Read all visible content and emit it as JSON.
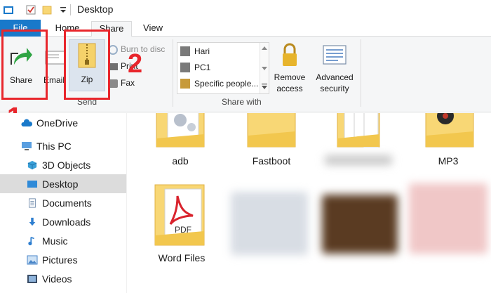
{
  "window": {
    "title": "Desktop"
  },
  "tabs": [
    {
      "label": "File"
    },
    {
      "label": "Home"
    },
    {
      "label": "Share"
    },
    {
      "label": "View"
    }
  ],
  "ribbon": {
    "send_group": {
      "label": "Send",
      "share_label": "Share",
      "email_label": "Email",
      "zip_label": "Zip",
      "burn_label": "Burn to disc",
      "print_label": "Print",
      "fax_label": "Fax"
    },
    "share_with_group": {
      "label": "Share with",
      "people": [
        "Hari",
        "PC1",
        "Specific people..."
      ],
      "remove_access_label": [
        "Remove",
        "access"
      ],
      "advanced_security_label": [
        "Advanced",
        "security"
      ]
    }
  },
  "annotations": {
    "step1": "1",
    "step2": "2"
  },
  "nav": {
    "items": [
      {
        "label": "OneDrive",
        "icon": "cloud-icon"
      },
      {
        "label": "This PC",
        "icon": "computer-icon"
      },
      {
        "label": "3D Objects",
        "icon": "cube-icon"
      },
      {
        "label": "Desktop",
        "icon": "desktop-icon"
      },
      {
        "label": "Documents",
        "icon": "document-icon"
      },
      {
        "label": "Downloads",
        "icon": "download-icon"
      },
      {
        "label": "Music",
        "icon": "music-icon"
      },
      {
        "label": "Pictures",
        "icon": "picture-icon"
      },
      {
        "label": "Videos",
        "icon": "video-icon"
      }
    ]
  },
  "files": [
    {
      "name": "adb"
    },
    {
      "name": "Fastboot"
    },
    {
      "name": "MP3"
    },
    {
      "name": "Word Files"
    }
  ],
  "colors": {
    "accent": "#1979ca",
    "highlight": "#e8262c",
    "ribbon_bg": "#f5f6f7",
    "folder": "#f8d775"
  }
}
